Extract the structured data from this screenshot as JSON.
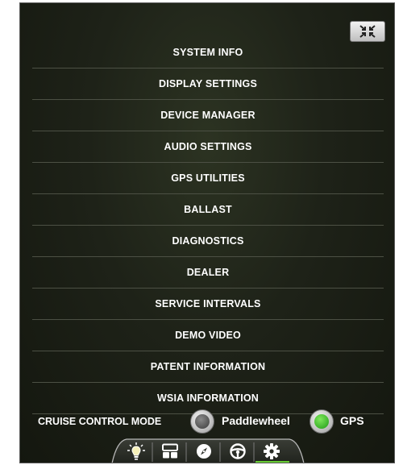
{
  "menu": {
    "items": [
      "SYSTEM INFO",
      "DISPLAY SETTINGS",
      "DEVICE MANAGER",
      "AUDIO SETTINGS",
      "GPS UTILITIES",
      "BALLAST",
      "DIAGNOSTICS",
      "DEALER",
      "SERVICE INTERVALS",
      "DEMO VIDEO",
      "PATENT INFORMATION",
      "WSIA INFORMATION"
    ]
  },
  "cruise": {
    "label": "CRUISE CONTROL MODE",
    "options": [
      {
        "label": "Paddlewheel",
        "selected": false
      },
      {
        "label": "GPS",
        "selected": true
      }
    ]
  },
  "icons": {
    "collapse": "collapse-icon",
    "tabs": [
      "lightbulb-icon",
      "panels-icon",
      "compass-icon",
      "steering-wheel-icon",
      "gear-icon"
    ]
  },
  "tabs": {
    "active": "settings"
  },
  "colors": {
    "background": "#1e2218",
    "divider": "#4c5044",
    "text": "#ffffff",
    "accent_green": "#2fb31c"
  }
}
